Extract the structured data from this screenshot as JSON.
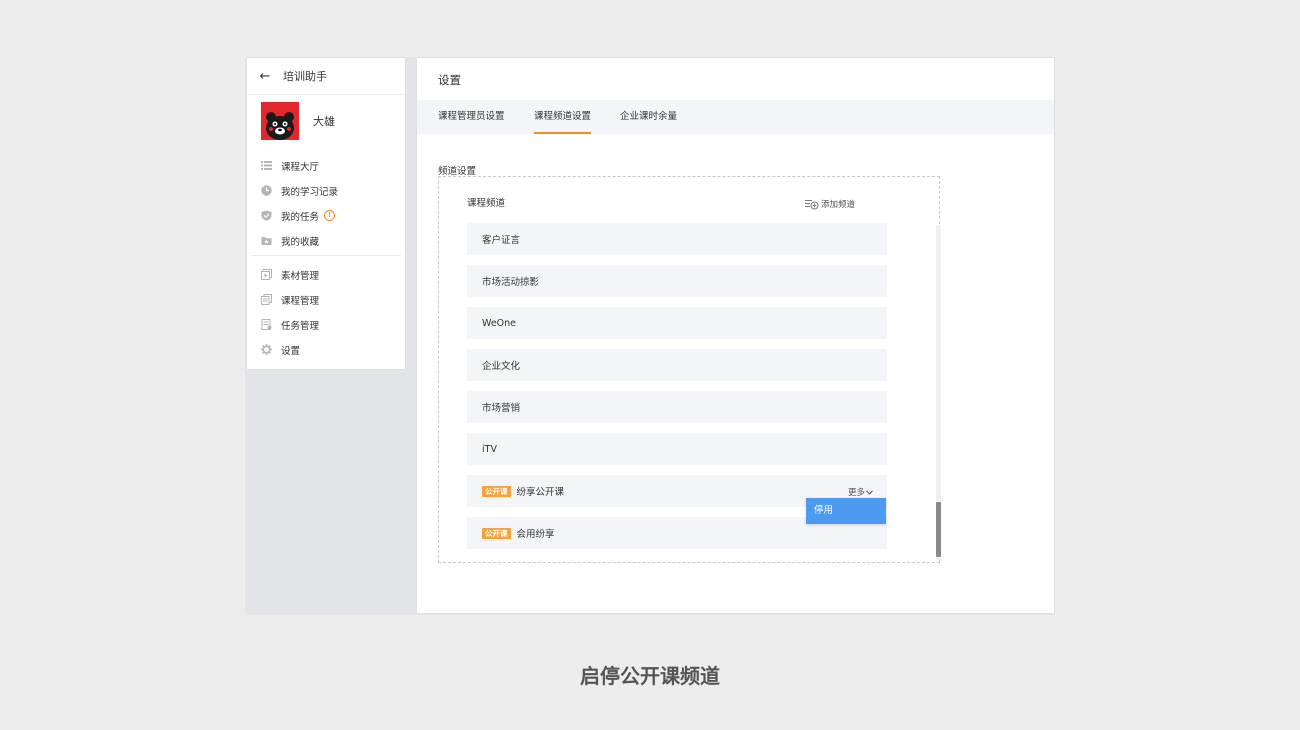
{
  "sidebar": {
    "app_name": "培训助手",
    "user_name": "大雄",
    "menu_primary": [
      {
        "label": "课程大厅",
        "icon": "list-icon"
      },
      {
        "label": "我的学习记录",
        "icon": "clock-icon"
      },
      {
        "label": "我的任务",
        "icon": "shield-icon",
        "badge": "!"
      },
      {
        "label": "我的收藏",
        "icon": "folder-icon"
      }
    ],
    "menu_admin": [
      {
        "label": "素材管理",
        "icon": "media-icon"
      },
      {
        "label": "课程管理",
        "icon": "copy-icon"
      },
      {
        "label": "任务管理",
        "icon": "doc-icon"
      },
      {
        "label": "设置",
        "icon": "gear-icon"
      }
    ]
  },
  "main": {
    "title": "设置",
    "tabs": [
      {
        "label": "课程管理员设置",
        "active": false
      },
      {
        "label": "课程频道设置",
        "active": true
      },
      {
        "label": "企业课时余量",
        "active": false
      }
    ],
    "section_label": "频道设置",
    "list_header": "课程频道",
    "add_channel_label": "添加频道",
    "channels": [
      {
        "name": "客户证言"
      },
      {
        "name": "市场活动掠影"
      },
      {
        "name": "WeOne"
      },
      {
        "name": "企业文化"
      },
      {
        "name": "市场营销"
      },
      {
        "name": "iTV"
      },
      {
        "name": "纷享公开课",
        "tag": "公开课",
        "more": "更多"
      },
      {
        "name": "会用纷享",
        "tag": "公开课"
      }
    ],
    "dropdown_item": "停用"
  },
  "caption": "启停公开课频道",
  "colors": {
    "accent": "#f08c1e",
    "tag": "#f5a13c",
    "dropdown": "#4d9bf0"
  }
}
